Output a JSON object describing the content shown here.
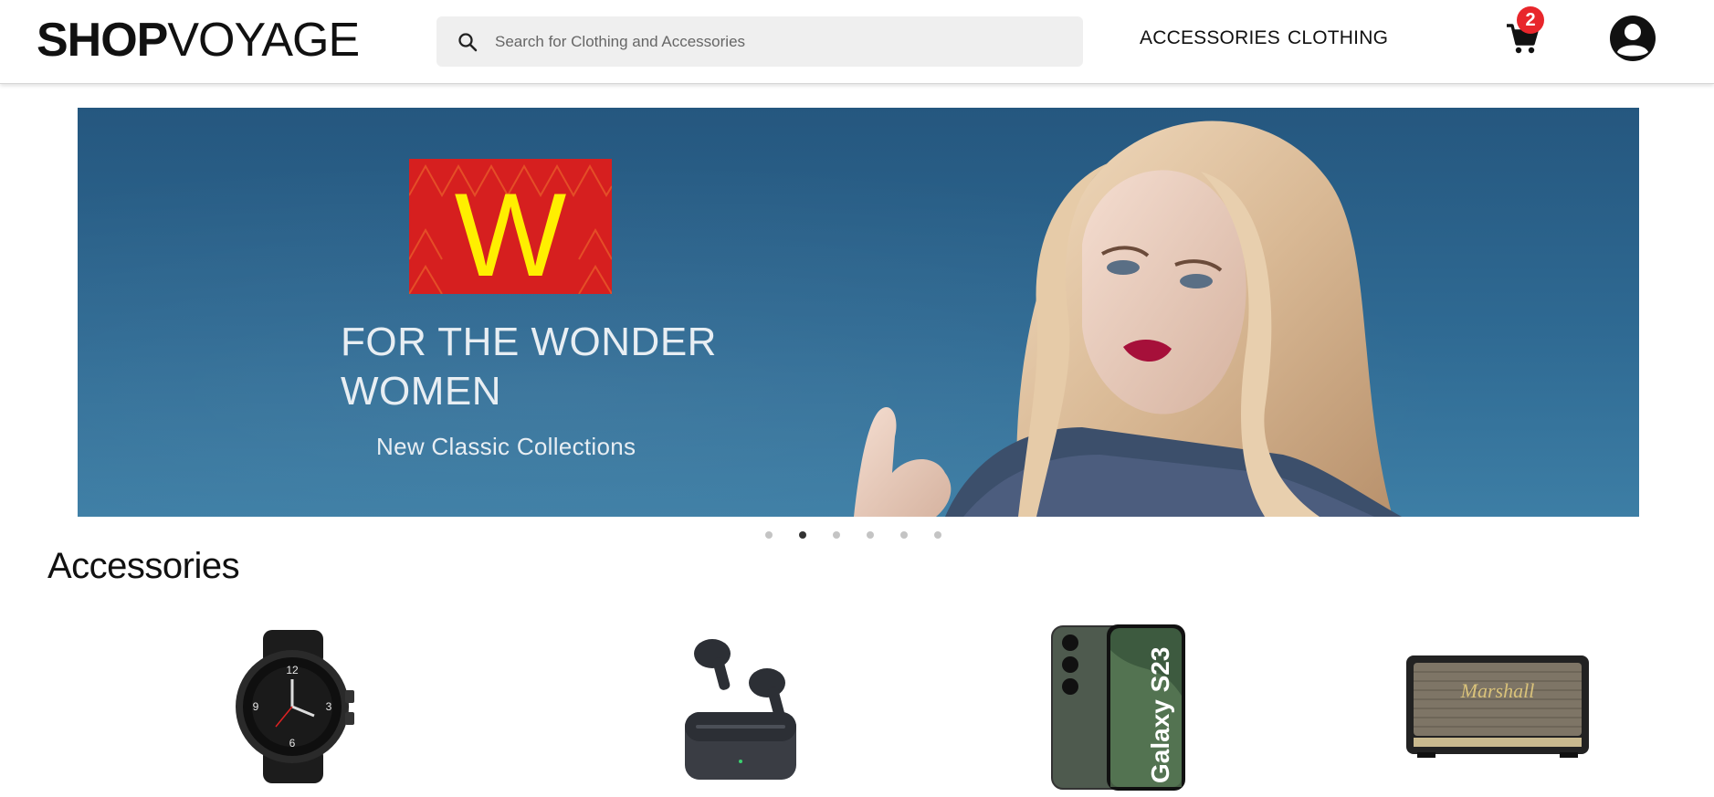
{
  "header": {
    "logo_bold": "SHOP",
    "logo_light": "VOYAGE",
    "search_placeholder": "Search for Clothing and Accessories",
    "nav": [
      "ACCESSORIES",
      "CLOTHING"
    ],
    "cart_count": "2",
    "icons": [
      "search-icon",
      "cart-icon",
      "account-icon"
    ],
    "colors": {
      "badge": "#e8262b"
    }
  },
  "banner": {
    "brand_letter": "W",
    "title": "FOR THE WONDER WOMEN",
    "subtitle": "New Classic Collections",
    "colors": {
      "background": "#2f6a93",
      "brand_red": "#d61f1f",
      "brand_yellow": "#ffef00"
    },
    "carousel_dots": 6,
    "active_dot": 2
  },
  "section": {
    "title": "Accessories",
    "products": [
      {
        "name": "smartwatch",
        "image_label": ""
      },
      {
        "name": "wireless-earbuds",
        "image_label": ""
      },
      {
        "name": "smartphone",
        "image_label": "Galaxy S23"
      },
      {
        "name": "speaker",
        "image_label": "Marshall"
      }
    ]
  }
}
